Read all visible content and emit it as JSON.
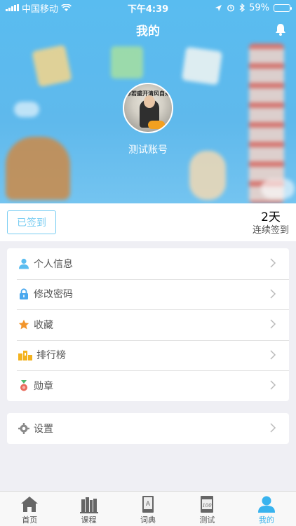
{
  "status_bar": {
    "carrier": "中国移动",
    "time": "下午4:39",
    "battery_percent": "59%",
    "battery_level": 0.59
  },
  "header": {
    "title": "我的",
    "bell_icon": "bell-icon",
    "background_color": "#5ab9ee"
  },
  "profile": {
    "account_name": "测试账号",
    "avatar_banner": "你若盛开清风自来"
  },
  "checkin": {
    "button_label": "已签到",
    "streak_days": "2天",
    "streak_label": "连续签到",
    "accent_color": "#79cdf2"
  },
  "menu": {
    "items": [
      {
        "label": "个人信息",
        "icon": "user-icon",
        "color": "#5bbdf0"
      },
      {
        "label": "修改密码",
        "icon": "lock-icon",
        "color": "#4aa8ee"
      },
      {
        "label": "收藏",
        "icon": "star-icon",
        "color": "#f2952b"
      },
      {
        "label": "排行榜",
        "icon": "podium-icon",
        "color": "#f3b21e"
      },
      {
        "label": "勋章",
        "icon": "medal-icon",
        "color": "#e86a5a"
      }
    ],
    "settings": {
      "label": "设置",
      "icon": "gear-icon",
      "color": "#8a8a8a"
    }
  },
  "tabbar": {
    "tabs": [
      {
        "label": "首页",
        "icon": "home-icon"
      },
      {
        "label": "课程",
        "icon": "books-icon"
      },
      {
        "label": "词典",
        "icon": "dictionary-icon"
      },
      {
        "label": "测试",
        "icon": "test-paper-icon"
      },
      {
        "label": "我的",
        "icon": "person-icon",
        "active": true
      }
    ],
    "active_color": "#38b3ee"
  }
}
